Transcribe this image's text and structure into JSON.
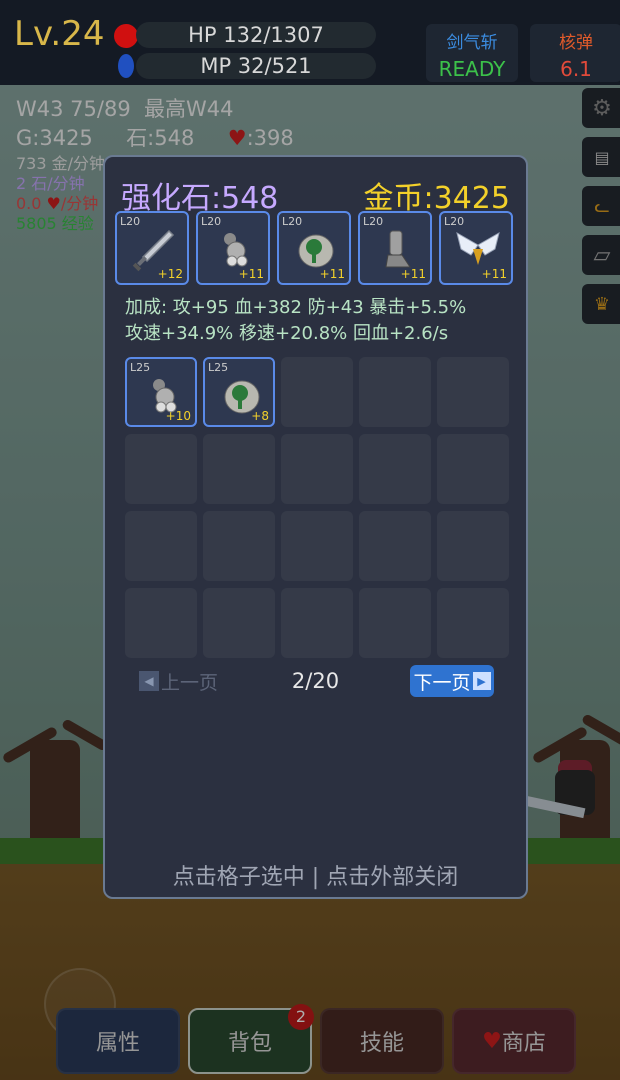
{
  "hud": {
    "level": "Lv.24",
    "hp_text": "HP 132/1307",
    "mp_text": "MP 32/521",
    "skill": {
      "name": "剑气斩",
      "status": "READY",
      "name_color": "#3b8ce0",
      "status_color": "#3cc14a"
    },
    "nuke": {
      "name": "核弹",
      "value": "6.1",
      "name_color": "#e05a2a",
      "value_color": "#e04a3a"
    }
  },
  "stats": {
    "wave": "W43 75/89",
    "best_wave": "最高W44",
    "gold": "G:3425",
    "stone": "石:548",
    "hearts": "398",
    "gold_rate": "733 金/分钟",
    "stone_rate": "2 石/分钟",
    "heart_rate_value": "0.0",
    "heart_rate_unit": "/分钟",
    "exp_rate": "5805 经验"
  },
  "side_buttons": [
    {
      "icon": "gear-icon",
      "glyph": "⚙"
    },
    {
      "icon": "book-icon",
      "glyph": "📖"
    },
    {
      "icon": "cat-icon",
      "glyph": "🐱"
    },
    {
      "icon": "scroll-icon",
      "glyph": "▱"
    },
    {
      "icon": "trophy-icon",
      "glyph": "🏆"
    }
  ],
  "bag": {
    "stone_label": "强化石:548",
    "gold_label": "金币:3425",
    "equipped": [
      {
        "level": "L20",
        "plus": "+12",
        "icon": "sword-icon"
      },
      {
        "level": "L20",
        "plus": "+11",
        "icon": "gauntlet-icon"
      },
      {
        "level": "L20",
        "plus": "+11",
        "icon": "helmet-icon"
      },
      {
        "level": "L20",
        "plus": "+11",
        "icon": "boots-icon"
      },
      {
        "level": "L20",
        "plus": "+11",
        "icon": "wings-icon"
      }
    ],
    "bonus_line1": "加成: 攻+95 血+382 防+43 暴击+5.5%",
    "bonus_line2": "攻速+34.9% 移速+20.8% 回血+2.6/s",
    "inventory": [
      {
        "level": "L25",
        "plus": "+10",
        "icon": "gauntlet-icon"
      },
      {
        "level": "L25",
        "plus": "+8",
        "icon": "helmet-icon"
      }
    ],
    "prev_label": "上一页",
    "page": "2/20",
    "next_label": "下一页",
    "hint": "点击格子选中 | 点击外部关闭"
  },
  "nav": {
    "attributes": "属性",
    "bag": "背包",
    "bag_badge": "2",
    "skills": "技能",
    "shop": "商店"
  },
  "colors": {
    "stone": "#c6a9ff",
    "gold": "#f3d12a",
    "equip_border": "#5a8ae8",
    "bonus_text": "#b8e3c4"
  }
}
